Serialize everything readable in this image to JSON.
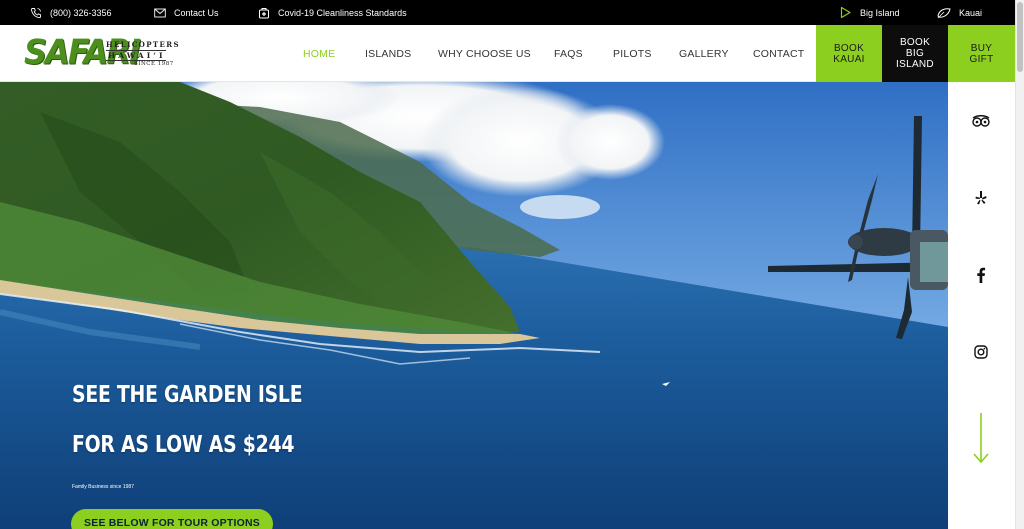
{
  "topbar": {
    "phone": "(800) 326-3356",
    "contact": "Contact Us",
    "covid": "Covid-19 Cleanliness Standards",
    "big_island": "Big Island",
    "kauai": "Kauai"
  },
  "logo": {
    "word": "SAFARI",
    "line1": "HELICOPTERS",
    "line2": "HAWAI‘I",
    "line3": "SINCE 1987"
  },
  "nav": {
    "home": "HOME",
    "islands": "ISLANDS",
    "why": "WHY CHOOSE US",
    "faqs": "FAQS",
    "pilots": "PILOTS",
    "gallery": "GALLERY",
    "contact": "CONTACT"
  },
  "cta": {
    "book_kauai": "BOOK KAUAI",
    "book_big_island": "BOOK BIG ISLAND",
    "buy_gift": "BUY GIFT"
  },
  "hero": {
    "line1": "SEE THE GARDEN ISLE",
    "line2": "FOR AS LOW AS $244",
    "tagline": "Family Business since 1987",
    "button": "SEE BELOW FOR TOUR OPTIONS"
  },
  "icons": [
    "phone-icon",
    "mail-icon",
    "shield-icon",
    "play-icon",
    "leaf-icon",
    "tripadvisor-icon",
    "yelp-icon",
    "facebook-icon",
    "instagram-icon",
    "arrow-down-icon"
  ],
  "colors": {
    "accent": "#8ccf1e",
    "topbar": "#000000",
    "ocean": "#1a5f9c"
  }
}
